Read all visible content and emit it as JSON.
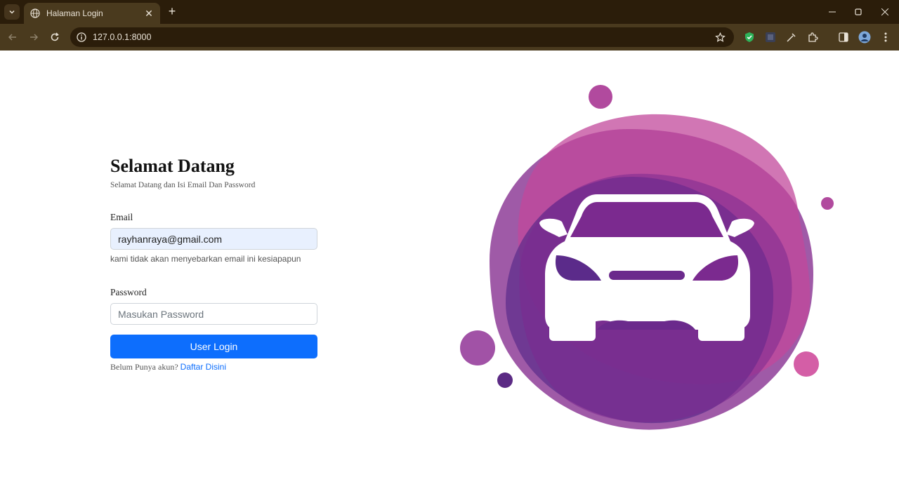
{
  "browser": {
    "tab_title": "Halaman Login",
    "url": "127.0.0.1:8000",
    "icons": [
      "tab-search-icon",
      "globe-icon",
      "close-icon",
      "plus-icon",
      "minimize-icon",
      "maximize-icon",
      "window-close-icon",
      "back-icon",
      "forward-icon",
      "reload-icon",
      "info-icon",
      "star-icon",
      "shield-extension-icon",
      "extension-icon",
      "brush-extension-icon",
      "puzzle-icon",
      "sidebar-icon",
      "profile-avatar",
      "more-icon"
    ]
  },
  "login": {
    "heading": "Selamat Datang",
    "subheading": "Selamat Datang dan Isi Email Dan Password",
    "email_label": "Email",
    "email_value": "rayhanraya@gmail.com",
    "email_help": "kami tidak akan menyebarkan email ini kesiapapun",
    "password_label": "Password",
    "password_placeholder": "Masukan Password",
    "login_button": "User Login",
    "register_prompt": "Belum Punya akun?",
    "register_link": "Daftar Disini"
  },
  "colors": {
    "primary": "#0d6efd",
    "chrome_dark": "#2b1d0a",
    "chrome_light": "#4a3a1e",
    "illustration_purple": "#7b2a8f",
    "illustration_magenta": "#c2489b"
  }
}
